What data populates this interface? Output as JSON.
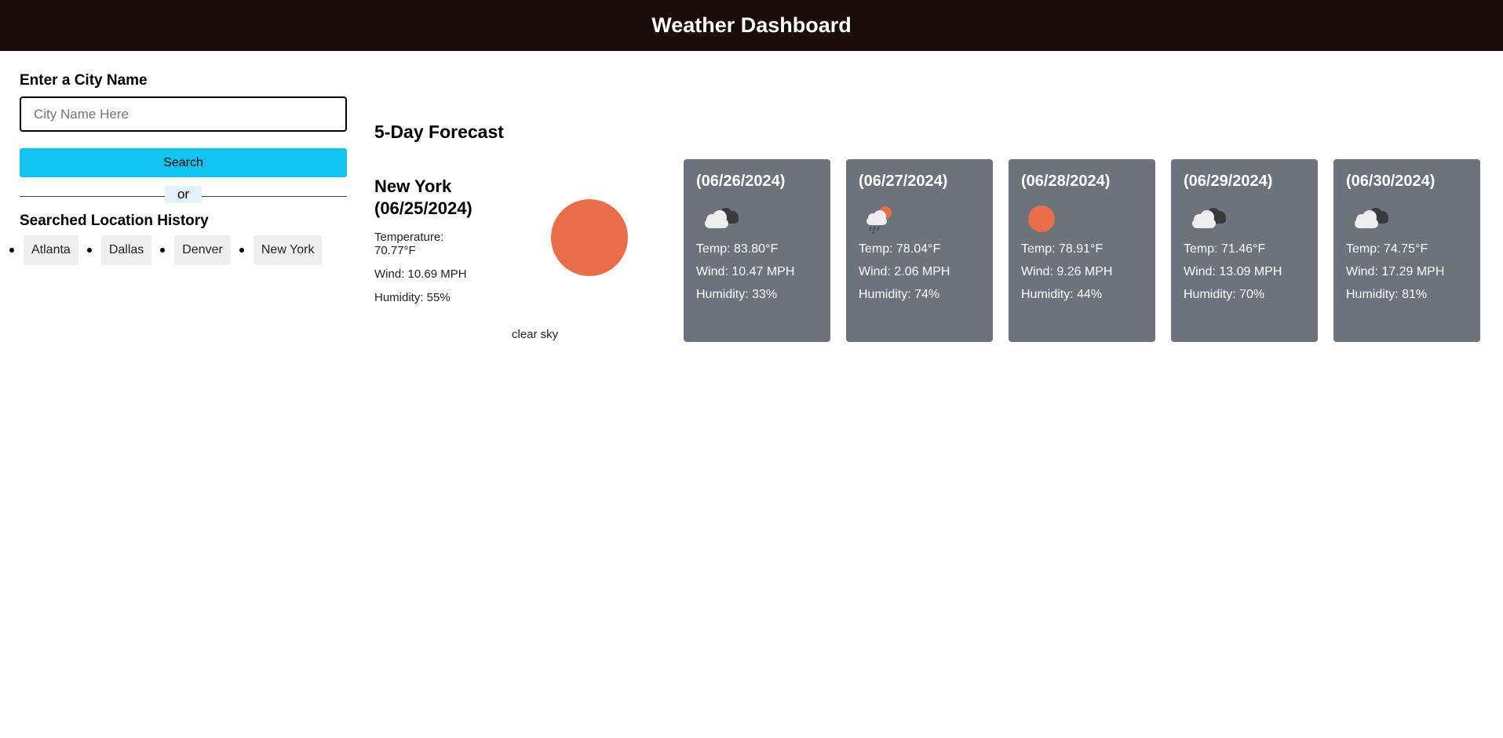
{
  "header": {
    "title": "Weather Dashboard"
  },
  "search": {
    "label": "Enter a City Name",
    "placeholder": "City Name Here",
    "button_label": "Search",
    "divider_text": "or"
  },
  "history": {
    "title": "Searched Location History",
    "items": [
      "Atlanta",
      "Dallas",
      "Denver",
      "New York"
    ]
  },
  "forecast_title": "5-Day Forecast",
  "current": {
    "city": "New York",
    "date": "(06/25/2024)",
    "temperature": "Temperature: 70.77°F",
    "wind": "Wind: 10.69 MPH",
    "humidity": "Humidity: 55%",
    "description": "clear sky",
    "icon": "sun-icon"
  },
  "days": [
    {
      "date": "(06/26/2024)",
      "icon": "broken-clouds-icon",
      "temp": "Temp: 83.80°F",
      "wind": "Wind: 10.47 MPH",
      "humidity": "Humidity: 33%"
    },
    {
      "date": "(06/27/2024)",
      "icon": "rain-sun-icon",
      "temp": "Temp: 78.04°F",
      "wind": "Wind: 2.06 MPH",
      "humidity": "Humidity: 74%"
    },
    {
      "date": "(06/28/2024)",
      "icon": "sun-icon",
      "temp": "Temp: 78.91°F",
      "wind": "Wind: 9.26 MPH",
      "humidity": "Humidity: 44%"
    },
    {
      "date": "(06/29/2024)",
      "icon": "broken-clouds-icon",
      "temp": "Temp: 71.46°F",
      "wind": "Wind: 13.09 MPH",
      "humidity": "Humidity: 70%"
    },
    {
      "date": "(06/30/2024)",
      "icon": "broken-clouds-icon",
      "temp": "Temp: 74.75°F",
      "wind": "Wind: 17.29 MPH",
      "humidity": "Humidity: 81%"
    }
  ],
  "colors": {
    "header_bg": "#1a0c0b",
    "search_button": "#13c3ef",
    "card_bg": "#6c737c",
    "sun": "#ea6d4a"
  }
}
